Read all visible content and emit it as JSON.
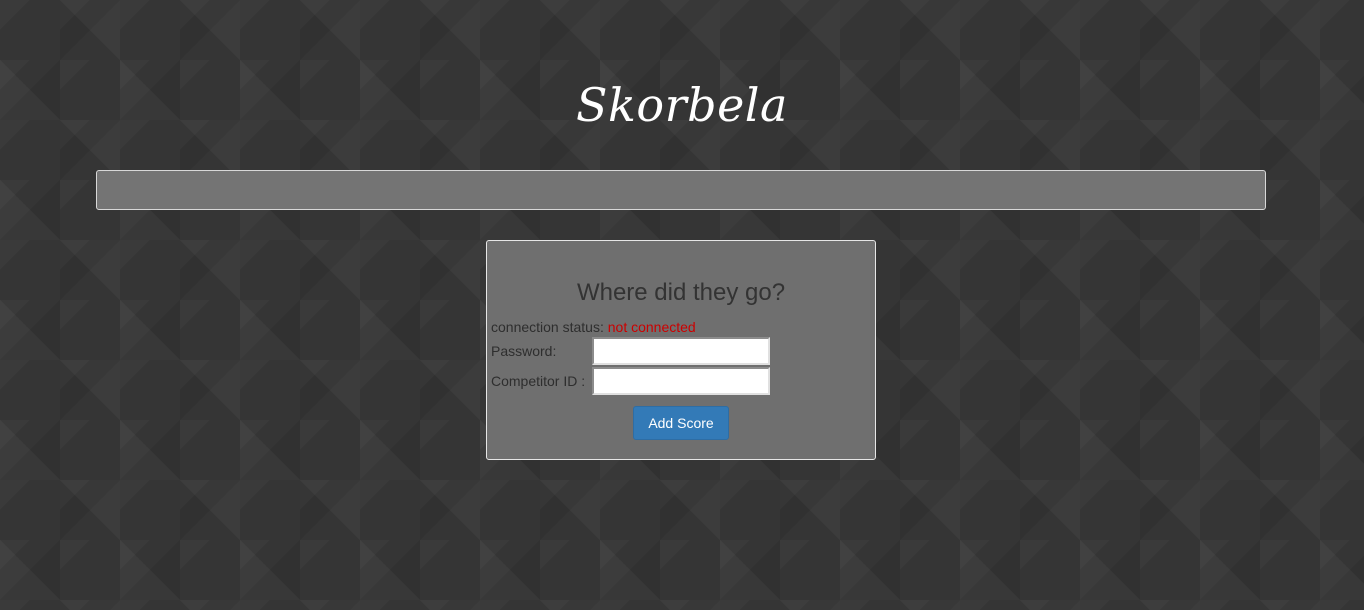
{
  "app": {
    "brand": "Skorbela"
  },
  "panel": {
    "title": "Where did they go?",
    "status_label": "connection status: ",
    "status_value": "not connected",
    "password_label": "Password:",
    "password_value": "",
    "competitor_label": "Competitor ID :",
    "competitor_value": "",
    "submit_label": "Add Score"
  },
  "colors": {
    "status_error": "#cc0000",
    "primary_button": "#337ab7",
    "panel_background": "#6f6f6f",
    "page_background": "#353535"
  }
}
